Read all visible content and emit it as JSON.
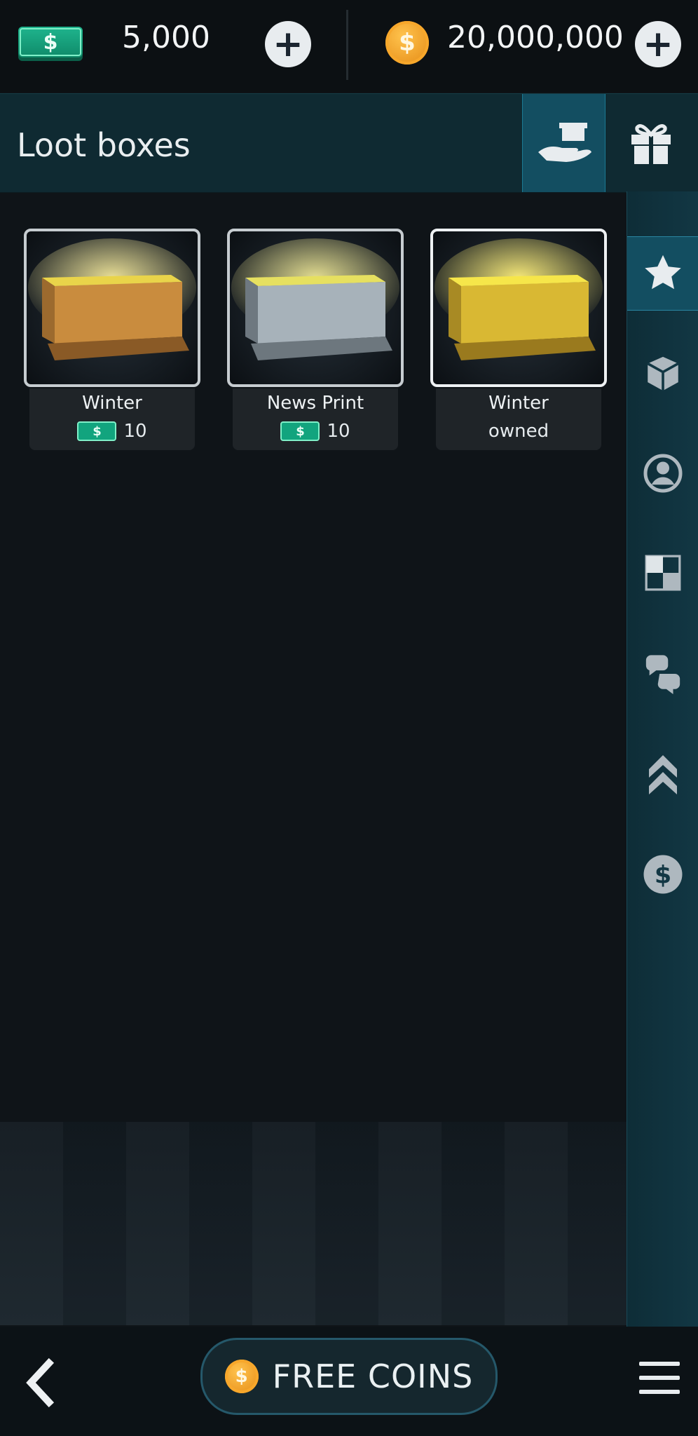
{
  "currency": {
    "cash_symbol": "$",
    "cash_amount": "5,000",
    "coin_symbol": "$",
    "coin_amount": "20,000,000"
  },
  "header": {
    "title": "Loot boxes"
  },
  "cards": [
    {
      "name": "Winter",
      "price_symbol": "$",
      "price": "10",
      "status": ""
    },
    {
      "name": "News Print",
      "price_symbol": "$",
      "price": "10",
      "status": ""
    },
    {
      "name": "Winter",
      "price_symbol": "",
      "price": "",
      "status": "owned"
    }
  ],
  "rail": {
    "items": [
      "star-icon",
      "box-icon",
      "profile-icon",
      "board-icon",
      "chat-icon",
      "rank-icon",
      "dollar-icon"
    ],
    "active": "star-icon"
  },
  "footer": {
    "free_coins_label": "FREE COINS",
    "coin_symbol": "$"
  },
  "colors": {
    "accent": "#134e61",
    "owned": "#e0a43a",
    "cash": "#12a47e",
    "coin": "#f2a22a"
  }
}
